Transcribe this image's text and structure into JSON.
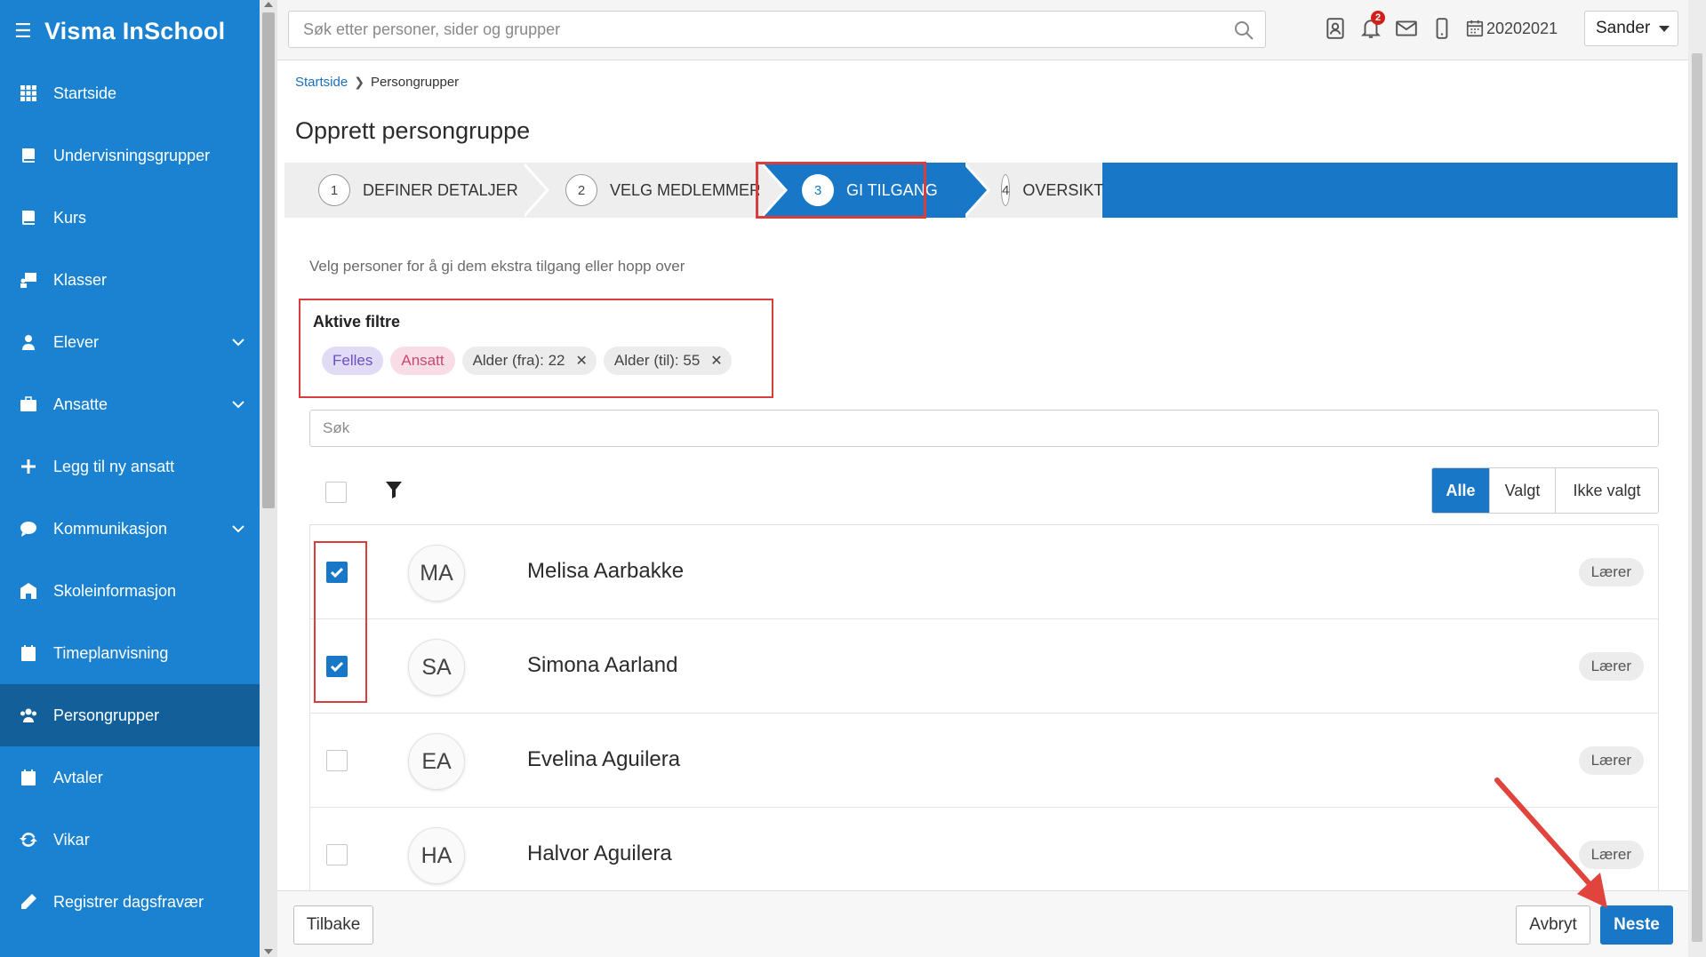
{
  "app": {
    "title": "Visma InSchool"
  },
  "colors": {
    "sidebar": "#1a82d0",
    "sidebar_active": "#125f9a",
    "primary": "#1878c7",
    "highlight": "#d93d3d"
  },
  "sidebar": {
    "items": [
      {
        "label": "Startside",
        "icon": "grid-icon"
      },
      {
        "label": "Undervisningsgrupper",
        "icon": "book-icon"
      },
      {
        "label": "Kurs",
        "icon": "book-icon"
      },
      {
        "label": "Klasser",
        "icon": "classroom-icon"
      },
      {
        "label": "Elever",
        "icon": "student-icon",
        "expandable": true
      },
      {
        "label": "Ansatte",
        "icon": "briefcase-icon",
        "expandable": true
      },
      {
        "label": "Legg til ny ansatt",
        "icon": "plus-icon"
      },
      {
        "label": "Kommunikasjon",
        "icon": "chat-icon",
        "expandable": true
      },
      {
        "label": "Skoleinformasjon",
        "icon": "school-icon"
      },
      {
        "label": "Timeplanvisning",
        "icon": "calendar-icon"
      },
      {
        "label": "Persongrupper",
        "icon": "users-icon",
        "active": true
      },
      {
        "label": "Avtaler",
        "icon": "calendar-check-icon"
      },
      {
        "label": "Vikar",
        "icon": "refresh-icon"
      },
      {
        "label": "Registrer dagsfravær",
        "icon": "pencil-icon"
      }
    ]
  },
  "topbar": {
    "search_placeholder": "Søk etter personer, sider og grupper",
    "notifications_count": "2",
    "year": "20202021",
    "user": "Sander"
  },
  "breadcrumb": {
    "home": "Startside",
    "current": "Persongrupper"
  },
  "page": {
    "title": "Opprett persongruppe",
    "subtitle": "Velg personer for å gi dem ekstra tilgang eller hopp over"
  },
  "wizard": {
    "steps": [
      {
        "num": "1",
        "label": "DEFINER DETALJER"
      },
      {
        "num": "2",
        "label": "VELG MEDLEMMER"
      },
      {
        "num": "3",
        "label": "GI TILGANG",
        "active": true
      },
      {
        "num": "4",
        "label": "OVERSIKT"
      }
    ]
  },
  "filters": {
    "title": "Aktive filtre",
    "chips": [
      "Felles",
      "Ansatt",
      "Alder (fra): 22",
      "Alder (til): 55"
    ]
  },
  "list_search": {
    "placeholder": "Søk"
  },
  "segmented": {
    "all": "Alle",
    "selected": "Valgt",
    "not_selected": "Ikke valgt"
  },
  "people": [
    {
      "initials": "MA",
      "name": "Melisa Aarbakke",
      "role": "Lærer",
      "checked": true
    },
    {
      "initials": "SA",
      "name": "Simona Aarland",
      "role": "Lærer",
      "checked": true
    },
    {
      "initials": "EA",
      "name": "Evelina Aguilera",
      "role": "Lærer",
      "checked": false
    },
    {
      "initials": "HA",
      "name": "Halvor Aguilera",
      "role": "Lærer",
      "checked": false
    }
  ],
  "footer": {
    "back": "Tilbake",
    "cancel": "Avbryt",
    "next": "Neste"
  }
}
